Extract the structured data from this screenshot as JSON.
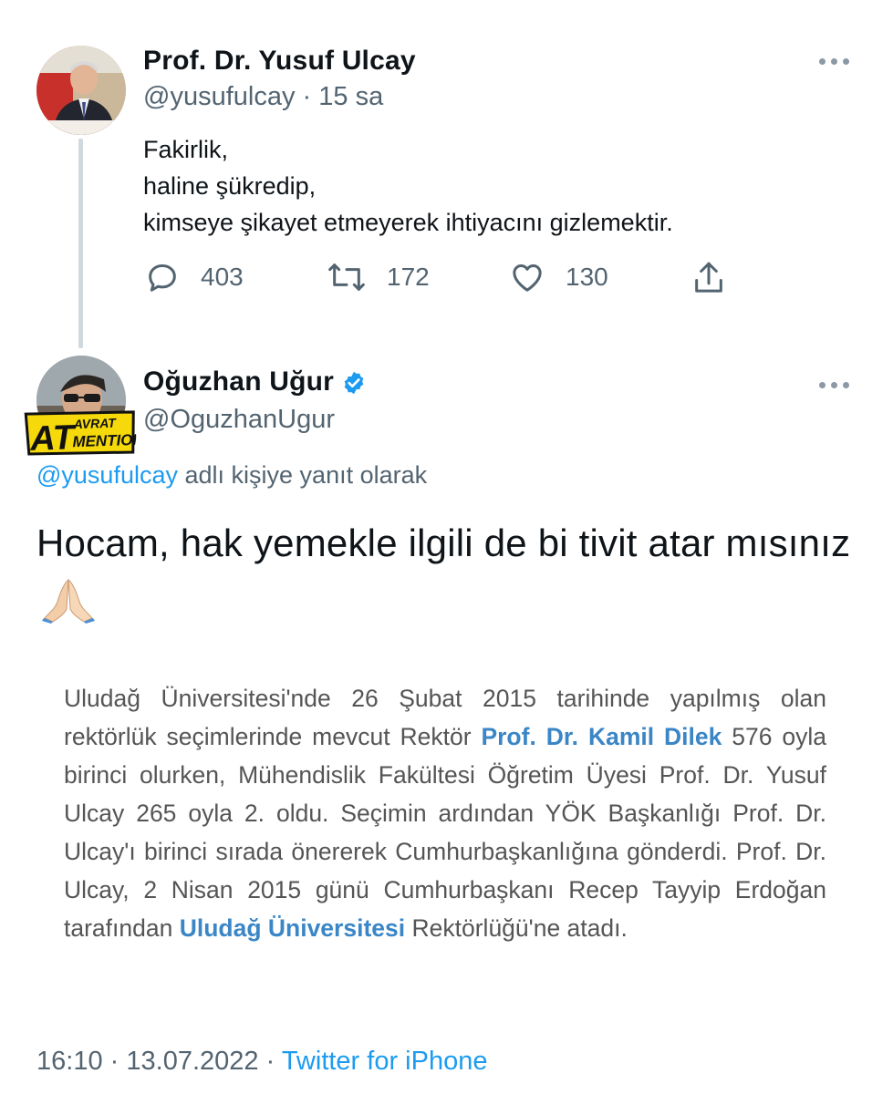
{
  "tweet1": {
    "author_name": "Prof. Dr. Yusuf Ulcay",
    "handle": "@yusufulcay",
    "separator": "·",
    "time_ago": "15 sa",
    "lines": [
      "Fakirlik,",
      "haline şükredip,",
      "kimseye şikayet etmeyerek ihtiyacını gizlemektir."
    ],
    "replies": "403",
    "retweets": "172",
    "likes": "130",
    "icons": [
      "reply-icon",
      "retweet-icon",
      "like-icon",
      "share-icon",
      "more-icon"
    ]
  },
  "tweet2": {
    "author_name": "Oğuzhan Uğur",
    "handle": "@OguzhanUgur",
    "verified": true,
    "badge": {
      "big": "AT",
      "top": "AVRAT",
      "bottom": "MENTION"
    },
    "reply_to_handle": "@yusufulcay",
    "reply_to_suffix": "adlı kişiye yanıt olarak",
    "text": "Hocam, hak yemekle ilgili de bi tivit atar mısınız",
    "emoji": "🙏🏻",
    "clipping": {
      "p1": "Uludağ Üniversitesi'nde 26 Şubat 2015 tarihinde yapılmış olan rektörlük seçimlerinde mevcut Rektör",
      "h1": "Prof. Dr. Kamil Dilek",
      "p2": "576 oyla birinci olurken, Mühendislik Fakültesi Öğretim Üyesi Prof. Dr. Yusuf Ulcay 265 oyla 2. oldu. Seçimin ardından YÖK Başkanlığı Prof. Dr. Ulcay'ı birinci sırada önererek Cumhurbaşkanlığına gönderdi. Prof. Dr. Ulcay, 2 Nisan 2015 günü Cumhurbaşkanı Recep Tayyip Erdoğan tarafından",
      "h2": "Uludağ Üniversitesi",
      "p3": "Rektörlüğü'ne atadı."
    },
    "time": "16:10",
    "date": "13.07.2022",
    "separator": "·",
    "source": "Twitter for iPhone"
  },
  "colors": {
    "link": "#1d9bf0",
    "secondary": "#536471",
    "highlight": "#3a86c6",
    "badge_yellow": "#f5d90a"
  }
}
